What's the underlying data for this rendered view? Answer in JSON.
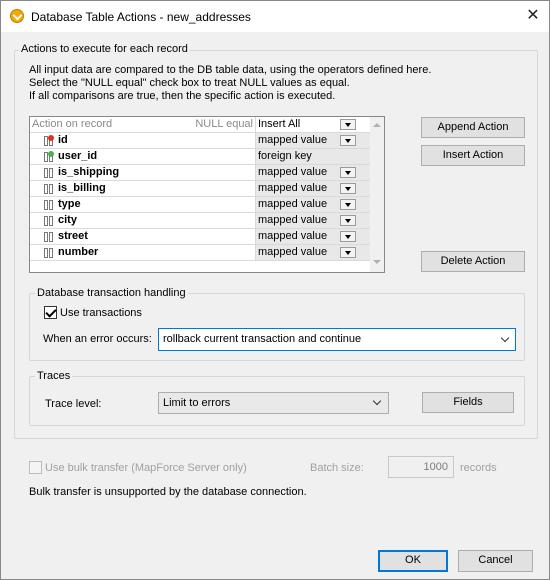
{
  "window": {
    "title": "Database Table Actions - new_addresses"
  },
  "actions_group": {
    "legend": "Actions to execute for each record",
    "description": [
      "All input data are compared to the DB table data, using the operators defined here.",
      "Select the \"NULL equal\" check box to treat NULL values as equal.",
      "If all comparisons are true, then the specific action is executed."
    ],
    "grid": {
      "header_name": "Action on record",
      "header_null": "NULL equal",
      "header_action": "Insert All",
      "rows": [
        {
          "field": "id",
          "action": "mapped value",
          "key": "primary"
        },
        {
          "field": "user_id",
          "action": "foreign key",
          "key": "foreign"
        },
        {
          "field": "is_shipping",
          "action": "mapped value",
          "key": ""
        },
        {
          "field": "is_billing",
          "action": "mapped value",
          "key": ""
        },
        {
          "field": "type",
          "action": "mapped value",
          "key": ""
        },
        {
          "field": "city",
          "action": "mapped value",
          "key": ""
        },
        {
          "field": "street",
          "action": "mapped value",
          "key": ""
        },
        {
          "field": "number",
          "action": "mapped value",
          "key": ""
        }
      ]
    },
    "buttons": {
      "append": "Append Action",
      "insert": "Insert Action",
      "delete": "Delete Action"
    }
  },
  "transaction_group": {
    "legend": "Database transaction handling",
    "use_transactions_label": "Use transactions",
    "use_transactions_checked": true,
    "error_label": "When an error occurs:",
    "error_value": "rollback current transaction and continue"
  },
  "traces_group": {
    "legend": "Traces",
    "level_label": "Trace level:",
    "level_value": "Limit to errors",
    "fields_button": "Fields"
  },
  "bulk": {
    "label": "Use bulk transfer (MapForce Server only)",
    "checked": false,
    "batch_label": "Batch size:",
    "batch_value": "1000",
    "batch_unit": "records",
    "note": "Bulk transfer is unsupported by the database connection."
  },
  "footer": {
    "ok": "OK",
    "cancel": "Cancel"
  },
  "colors": {
    "accent": "#0078d7",
    "primary_key": "#e0301e",
    "foreign_key": "#4caf50"
  }
}
